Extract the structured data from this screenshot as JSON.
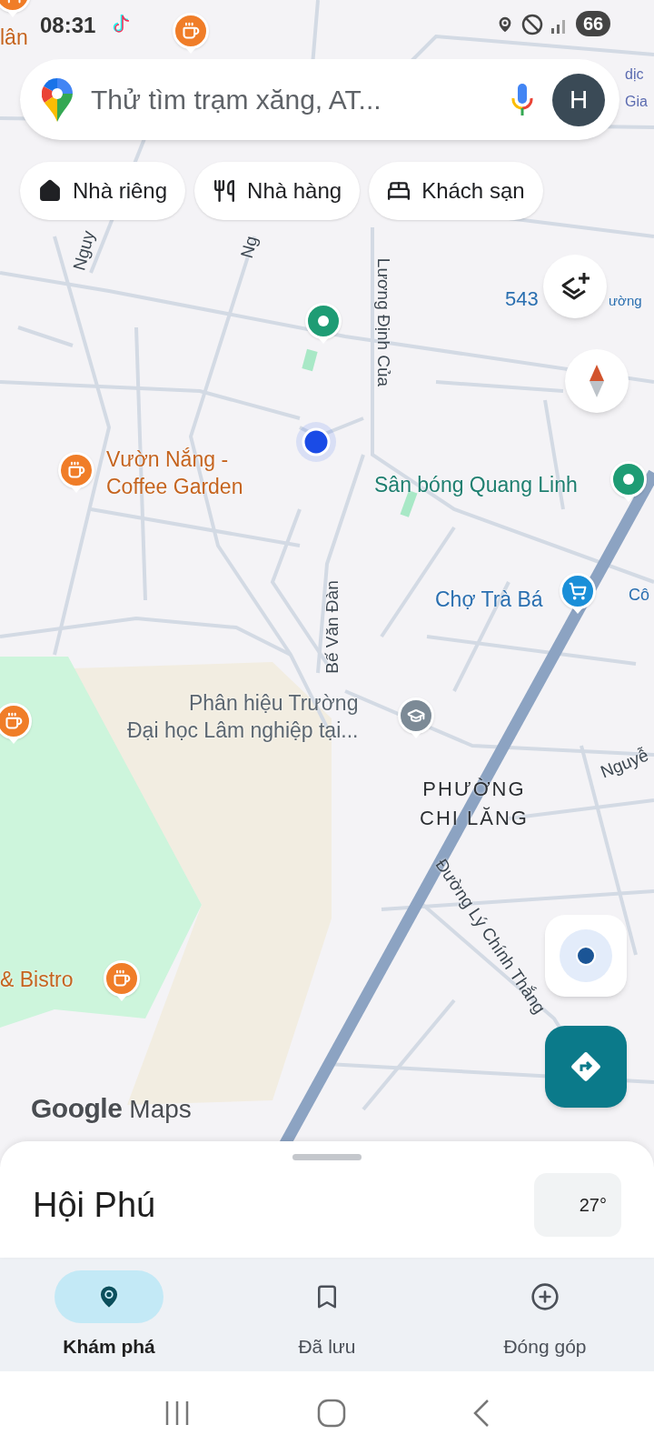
{
  "status_bar": {
    "time": "08:31",
    "battery": "66"
  },
  "search": {
    "placeholder": "Thử tìm trạm xăng, AT...",
    "avatar_letter": "H"
  },
  "chips": [
    {
      "kind": "home",
      "label": "Nhà riêng"
    },
    {
      "kind": "restaurant",
      "label": "Nhà hàng"
    },
    {
      "kind": "hotel",
      "label": "Khách sạn"
    }
  ],
  "map": {
    "places": [
      {
        "kind": "restaurant",
        "lines": [
          "lân"
        ]
      },
      {
        "kind": "cafe"
      },
      {
        "kind": "park"
      },
      {
        "kind": "cafe",
        "lines": [
          "Vườn Nắng -",
          "Coffee Garden"
        ]
      },
      {
        "kind": "park",
        "lines": [
          "Sân bóng Quang Linh"
        ]
      },
      {
        "kind": "market",
        "lines": [
          "Chợ Trà Bá"
        ]
      },
      {
        "kind": "school",
        "lines": [
          "Phân hiệu Trường",
          "Đại học Lâm nghiệp tại..."
        ]
      },
      {
        "kind": "cafe"
      },
      {
        "kind": "cafe",
        "lines": [
          "& Bistro"
        ]
      }
    ],
    "road_labels": [
      "Nguy",
      "Ng",
      "Lương Định Của",
      "Bế Văn Đàn",
      "Đường Lý Chính Thắng",
      "Nguyễ"
    ],
    "edge_labels": [
      "dịc",
      "Gia",
      "543",
      "ường",
      "Cô"
    ],
    "area_label": [
      "PHƯỜNG",
      "CHI LĂNG"
    ],
    "attribution": {
      "brand": "Google",
      "product": "Maps"
    }
  },
  "sheet": {
    "title": "Hội Phú",
    "temperature": "27°"
  },
  "nav": [
    {
      "kind": "explore",
      "label": "Khám phá",
      "selected": true
    },
    {
      "kind": "saved",
      "label": "Đã lưu",
      "selected": false
    },
    {
      "kind": "contribute",
      "label": "Đóng góp",
      "selected": false
    }
  ]
}
